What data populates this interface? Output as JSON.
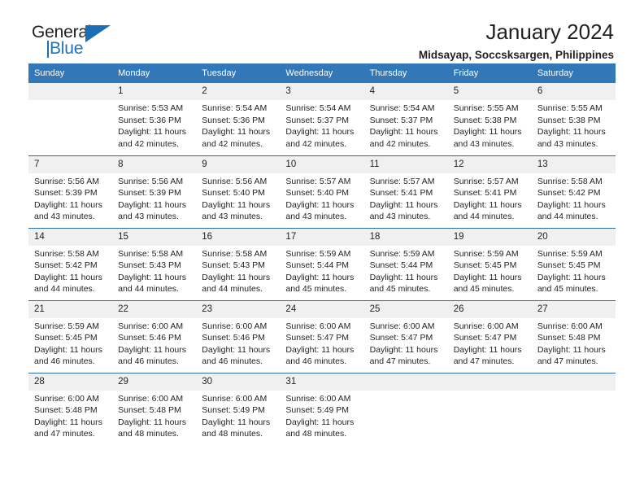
{
  "brand": {
    "name_part1": "General",
    "name_part2": "Blue",
    "triangle_color": "#1b6eb3",
    "blue_color": "#2272b8"
  },
  "header": {
    "title": "January 2024",
    "subtitle": "Midsayap, Soccsksargen, Philippines"
  },
  "theme": {
    "header_bg": "#3277b8",
    "row_divider": "#2e6da4",
    "daynum_bg": "#f0f0f0",
    "text": "#231f20"
  },
  "weekdays": [
    "Sunday",
    "Monday",
    "Tuesday",
    "Wednesday",
    "Thursday",
    "Friday",
    "Saturday"
  ],
  "weeks": [
    [
      {
        "day": "",
        "sunrise": "",
        "sunset": "",
        "daylight1": "",
        "daylight2": ""
      },
      {
        "day": "1",
        "sunrise": "Sunrise: 5:53 AM",
        "sunset": "Sunset: 5:36 PM",
        "daylight1": "Daylight: 11 hours",
        "daylight2": "and 42 minutes."
      },
      {
        "day": "2",
        "sunrise": "Sunrise: 5:54 AM",
        "sunset": "Sunset: 5:36 PM",
        "daylight1": "Daylight: 11 hours",
        "daylight2": "and 42 minutes."
      },
      {
        "day": "3",
        "sunrise": "Sunrise: 5:54 AM",
        "sunset": "Sunset: 5:37 PM",
        "daylight1": "Daylight: 11 hours",
        "daylight2": "and 42 minutes."
      },
      {
        "day": "4",
        "sunrise": "Sunrise: 5:54 AM",
        "sunset": "Sunset: 5:37 PM",
        "daylight1": "Daylight: 11 hours",
        "daylight2": "and 42 minutes."
      },
      {
        "day": "5",
        "sunrise": "Sunrise: 5:55 AM",
        "sunset": "Sunset: 5:38 PM",
        "daylight1": "Daylight: 11 hours",
        "daylight2": "and 43 minutes."
      },
      {
        "day": "6",
        "sunrise": "Sunrise: 5:55 AM",
        "sunset": "Sunset: 5:38 PM",
        "daylight1": "Daylight: 11 hours",
        "daylight2": "and 43 minutes."
      }
    ],
    [
      {
        "day": "7",
        "sunrise": "Sunrise: 5:56 AM",
        "sunset": "Sunset: 5:39 PM",
        "daylight1": "Daylight: 11 hours",
        "daylight2": "and 43 minutes."
      },
      {
        "day": "8",
        "sunrise": "Sunrise: 5:56 AM",
        "sunset": "Sunset: 5:39 PM",
        "daylight1": "Daylight: 11 hours",
        "daylight2": "and 43 minutes."
      },
      {
        "day": "9",
        "sunrise": "Sunrise: 5:56 AM",
        "sunset": "Sunset: 5:40 PM",
        "daylight1": "Daylight: 11 hours",
        "daylight2": "and 43 minutes."
      },
      {
        "day": "10",
        "sunrise": "Sunrise: 5:57 AM",
        "sunset": "Sunset: 5:40 PM",
        "daylight1": "Daylight: 11 hours",
        "daylight2": "and 43 minutes."
      },
      {
        "day": "11",
        "sunrise": "Sunrise: 5:57 AM",
        "sunset": "Sunset: 5:41 PM",
        "daylight1": "Daylight: 11 hours",
        "daylight2": "and 43 minutes."
      },
      {
        "day": "12",
        "sunrise": "Sunrise: 5:57 AM",
        "sunset": "Sunset: 5:41 PM",
        "daylight1": "Daylight: 11 hours",
        "daylight2": "and 44 minutes."
      },
      {
        "day": "13",
        "sunrise": "Sunrise: 5:58 AM",
        "sunset": "Sunset: 5:42 PM",
        "daylight1": "Daylight: 11 hours",
        "daylight2": "and 44 minutes."
      }
    ],
    [
      {
        "day": "14",
        "sunrise": "Sunrise: 5:58 AM",
        "sunset": "Sunset: 5:42 PM",
        "daylight1": "Daylight: 11 hours",
        "daylight2": "and 44 minutes."
      },
      {
        "day": "15",
        "sunrise": "Sunrise: 5:58 AM",
        "sunset": "Sunset: 5:43 PM",
        "daylight1": "Daylight: 11 hours",
        "daylight2": "and 44 minutes."
      },
      {
        "day": "16",
        "sunrise": "Sunrise: 5:58 AM",
        "sunset": "Sunset: 5:43 PM",
        "daylight1": "Daylight: 11 hours",
        "daylight2": "and 44 minutes."
      },
      {
        "day": "17",
        "sunrise": "Sunrise: 5:59 AM",
        "sunset": "Sunset: 5:44 PM",
        "daylight1": "Daylight: 11 hours",
        "daylight2": "and 45 minutes."
      },
      {
        "day": "18",
        "sunrise": "Sunrise: 5:59 AM",
        "sunset": "Sunset: 5:44 PM",
        "daylight1": "Daylight: 11 hours",
        "daylight2": "and 45 minutes."
      },
      {
        "day": "19",
        "sunrise": "Sunrise: 5:59 AM",
        "sunset": "Sunset: 5:45 PM",
        "daylight1": "Daylight: 11 hours",
        "daylight2": "and 45 minutes."
      },
      {
        "day": "20",
        "sunrise": "Sunrise: 5:59 AM",
        "sunset": "Sunset: 5:45 PM",
        "daylight1": "Daylight: 11 hours",
        "daylight2": "and 45 minutes."
      }
    ],
    [
      {
        "day": "21",
        "sunrise": "Sunrise: 5:59 AM",
        "sunset": "Sunset: 5:45 PM",
        "daylight1": "Daylight: 11 hours",
        "daylight2": "and 46 minutes."
      },
      {
        "day": "22",
        "sunrise": "Sunrise: 6:00 AM",
        "sunset": "Sunset: 5:46 PM",
        "daylight1": "Daylight: 11 hours",
        "daylight2": "and 46 minutes."
      },
      {
        "day": "23",
        "sunrise": "Sunrise: 6:00 AM",
        "sunset": "Sunset: 5:46 PM",
        "daylight1": "Daylight: 11 hours",
        "daylight2": "and 46 minutes."
      },
      {
        "day": "24",
        "sunrise": "Sunrise: 6:00 AM",
        "sunset": "Sunset: 5:47 PM",
        "daylight1": "Daylight: 11 hours",
        "daylight2": "and 46 minutes."
      },
      {
        "day": "25",
        "sunrise": "Sunrise: 6:00 AM",
        "sunset": "Sunset: 5:47 PM",
        "daylight1": "Daylight: 11 hours",
        "daylight2": "and 47 minutes."
      },
      {
        "day": "26",
        "sunrise": "Sunrise: 6:00 AM",
        "sunset": "Sunset: 5:47 PM",
        "daylight1": "Daylight: 11 hours",
        "daylight2": "and 47 minutes."
      },
      {
        "day": "27",
        "sunrise": "Sunrise: 6:00 AM",
        "sunset": "Sunset: 5:48 PM",
        "daylight1": "Daylight: 11 hours",
        "daylight2": "and 47 minutes."
      }
    ],
    [
      {
        "day": "28",
        "sunrise": "Sunrise: 6:00 AM",
        "sunset": "Sunset: 5:48 PM",
        "daylight1": "Daylight: 11 hours",
        "daylight2": "and 47 minutes."
      },
      {
        "day": "29",
        "sunrise": "Sunrise: 6:00 AM",
        "sunset": "Sunset: 5:48 PM",
        "daylight1": "Daylight: 11 hours",
        "daylight2": "and 48 minutes."
      },
      {
        "day": "30",
        "sunrise": "Sunrise: 6:00 AM",
        "sunset": "Sunset: 5:49 PM",
        "daylight1": "Daylight: 11 hours",
        "daylight2": "and 48 minutes."
      },
      {
        "day": "31",
        "sunrise": "Sunrise: 6:00 AM",
        "sunset": "Sunset: 5:49 PM",
        "daylight1": "Daylight: 11 hours",
        "daylight2": "and 48 minutes."
      },
      {
        "day": "",
        "sunrise": "",
        "sunset": "",
        "daylight1": "",
        "daylight2": ""
      },
      {
        "day": "",
        "sunrise": "",
        "sunset": "",
        "daylight1": "",
        "daylight2": ""
      },
      {
        "day": "",
        "sunrise": "",
        "sunset": "",
        "daylight1": "",
        "daylight2": ""
      }
    ]
  ]
}
